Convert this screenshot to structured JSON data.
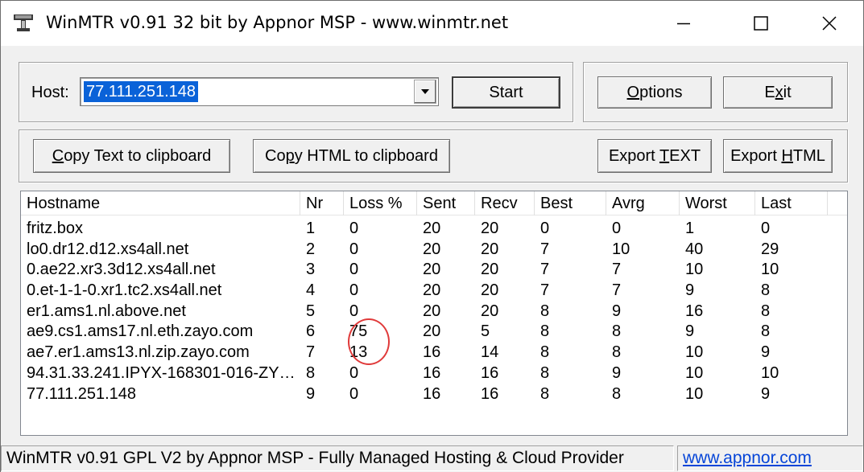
{
  "window": {
    "title": "WinMTR v0.91 32 bit by Appnor MSP - www.winmtr.net",
    "icon": "winmtr-app-icon",
    "controls": [
      "minimize-icon",
      "maximize-icon",
      "close-icon"
    ]
  },
  "host": {
    "label": "Host:",
    "value": "77.111.251.148"
  },
  "buttons": {
    "start": "Start",
    "options_pre": "",
    "options_ul": "O",
    "options_post": "ptions",
    "exit_pre": "E",
    "exit_ul": "x",
    "exit_post": "it",
    "copy_text_pre": "",
    "copy_text_ul": "C",
    "copy_text_post": "opy Text to clipboard",
    "copy_html_pre": "Co",
    "copy_html_ul": "p",
    "copy_html_post": "y HTML to clipboard",
    "export_text_pre": "Export ",
    "export_text_ul": "T",
    "export_text_post": "EXT",
    "export_html_pre": "Export ",
    "export_html_ul": "H",
    "export_html_post": "TML"
  },
  "table": {
    "columns": [
      "Hostname",
      "Nr",
      "Loss %",
      "Sent",
      "Recv",
      "Best",
      "Avrg",
      "Worst",
      "Last"
    ],
    "rows": [
      [
        "fritz.box",
        "1",
        "0",
        "20",
        "20",
        "0",
        "0",
        "1",
        "0"
      ],
      [
        "lo0.dr12.d12.xs4all.net",
        "2",
        "0",
        "20",
        "20",
        "7",
        "10",
        "40",
        "29"
      ],
      [
        "0.ae22.xr3.3d12.xs4all.net",
        "3",
        "0",
        "20",
        "20",
        "7",
        "7",
        "10",
        "10"
      ],
      [
        "0.et-1-1-0.xr1.tc2.xs4all.net",
        "4",
        "0",
        "20",
        "20",
        "7",
        "7",
        "9",
        "8"
      ],
      [
        "er1.ams1.nl.above.net",
        "5",
        "0",
        "20",
        "20",
        "8",
        "9",
        "16",
        "8"
      ],
      [
        "ae9.cs1.ams17.nl.eth.zayo.com",
        "6",
        "75",
        "20",
        "5",
        "8",
        "8",
        "9",
        "8"
      ],
      [
        "ae7.er1.ams13.nl.zip.zayo.com",
        "7",
        "13",
        "16",
        "14",
        "8",
        "8",
        "10",
        "9"
      ],
      [
        "94.31.33.241.IPYX-168301-016-ZYO...",
        "8",
        "0",
        "16",
        "16",
        "8",
        "9",
        "10",
        "10"
      ],
      [
        "77.111.251.148",
        "9",
        "0",
        "16",
        "16",
        "8",
        "8",
        "10",
        "9"
      ]
    ],
    "annotation_color": "#e03a3a"
  },
  "status": {
    "text": "WinMTR v0.91 GPL V2 by Appnor MSP - Fully Managed Hosting & Cloud Provider",
    "link": "www.appnor.com"
  },
  "colors": {
    "selection": "#0a62d8",
    "link": "#0645d8",
    "face": "#f0f0f0"
  }
}
